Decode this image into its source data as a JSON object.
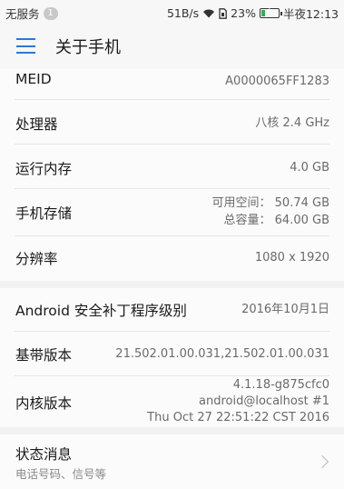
{
  "status_bar": {
    "carrier": "无服务",
    "notification_count": "1",
    "net_speed": "51B/s",
    "battery_percent": "23%",
    "battery_level": 0.23,
    "time": "半夜12:13"
  },
  "header": {
    "title": "关于手机"
  },
  "rows": {
    "meid": {
      "label": "MEID",
      "value": "A0000065FF1283"
    },
    "cpu": {
      "label": "处理器",
      "value": "八核 2.4 GHz"
    },
    "ram": {
      "label": "运行内存",
      "value": "4.0 GB"
    },
    "storage": {
      "label": "手机存储",
      "available": "可用空间： 50.74  GB",
      "total": "总容量： 64.00  GB"
    },
    "resolution": {
      "label": "分辨率",
      "value": "1080 x 1920"
    },
    "security_patch": {
      "label": "Android 安全补丁程序级别",
      "value": "2016年10月1日"
    },
    "baseband": {
      "label": "基带版本",
      "value": "21.502.01.00.031,21.502.01.00.031"
    },
    "kernel": {
      "label": "内核版本",
      "line1": "4.1.18-g875cfc0",
      "line2": "android@localhost #1",
      "line3": "Thu Oct 27 22:51:22 CST 2016"
    },
    "status": {
      "label": "状态消息",
      "subtitle": "电话号码、信号等"
    }
  },
  "colors": {
    "accent": "#2e76d8",
    "background": "#f2f2f2",
    "card": "#fbfbfb"
  }
}
